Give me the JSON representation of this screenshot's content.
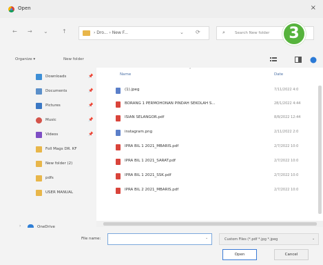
{
  "window": {
    "title": "Open",
    "close_label": "×"
  },
  "nav": {
    "back": "←",
    "forward": "→",
    "up_history": "⌄",
    "up": "↑",
    "path": "›  Dro...  ›  New F...",
    "path_dropdown": "⌄",
    "refresh": "⟳",
    "search_icon": "⌕",
    "search_placeholder": "Search New folder"
  },
  "step_badge": "3",
  "toolbar": {
    "organize": "Organize ▾",
    "new_folder": "New folder"
  },
  "sidebar": {
    "items": [
      {
        "label": "Downloads",
        "icon": "download-icon",
        "color": "#3d8fd6",
        "pin": "📌"
      },
      {
        "label": "Documents",
        "icon": "document-icon",
        "color": "#5b8fc9",
        "pin": "📌"
      },
      {
        "label": "Pictures",
        "icon": "pictures-icon",
        "color": "#3b78c4",
        "pin": "📌"
      },
      {
        "label": "Music",
        "icon": "music-icon",
        "color": "#d4534a",
        "pin": "📌"
      },
      {
        "label": "Videos",
        "icon": "videos-icon",
        "color": "#7e4ec4",
        "pin": "📌"
      },
      {
        "label": "Foll Mags DR. KF",
        "icon": "folder-icon",
        "color": "#e8b64a",
        "pin": ""
      },
      {
        "label": "New folder (2)",
        "icon": "folder-icon",
        "color": "#e8b64a",
        "pin": ""
      },
      {
        "label": "pdfs",
        "icon": "folder-icon",
        "color": "#e8b64a",
        "pin": ""
      },
      {
        "label": "USER MANUAL",
        "icon": "folder-icon",
        "color": "#e8b64a",
        "pin": ""
      },
      {
        "label": "OneDrive",
        "icon": "cloud-icon",
        "color": "#2f7fd6",
        "pin": ""
      }
    ]
  },
  "files": {
    "headers": {
      "name": "Name",
      "date": "Date"
    },
    "rows": [
      {
        "name": "(1).jpeg",
        "date": "7/11/2022 4:0",
        "icon": "image-file-icon",
        "color": "#5b7fc9"
      },
      {
        "name": "BORANG 1 PERMOHONAN PINDAH SEKOLAH S...",
        "date": "28/1/2022 4:44",
        "icon": "pdf-file-icon",
        "color": "#d9443b"
      },
      {
        "name": "ISIAN SELANGOR.pdf",
        "date": "8/8/2022 12:44",
        "icon": "pdf-file-icon",
        "color": "#d9443b"
      },
      {
        "name": "instagram.png",
        "date": "2/11/2022 2:0",
        "icon": "image-file-icon",
        "color": "#5b7fc9"
      },
      {
        "name": "IPRA BIL 1 2021_MBARIS.pdf",
        "date": "2/7/2022 10:0",
        "icon": "pdf-file-icon",
        "color": "#d9443b"
      },
      {
        "name": "IPRA BIL 1 2021_SARAT.pdf",
        "date": "2/7/2022 10:0",
        "icon": "pdf-file-icon",
        "color": "#d9443b"
      },
      {
        "name": "IPRA BIL 1 2021_SSK.pdf",
        "date": "2/7/2022 10:0",
        "icon": "pdf-file-icon",
        "color": "#d9443b"
      },
      {
        "name": "IPRA BIL 2 2021_MBARIS.pdf",
        "date": "2/7/2022 10:0",
        "icon": "pdf-file-icon",
        "color": "#d9443b"
      }
    ]
  },
  "bottom": {
    "file_name_label": "File name:",
    "file_name_value": "",
    "filter_label": "Custom Files (*.pdf *.jpg *.jpeg",
    "open_label": "Open",
    "cancel_label": "Cancel"
  }
}
